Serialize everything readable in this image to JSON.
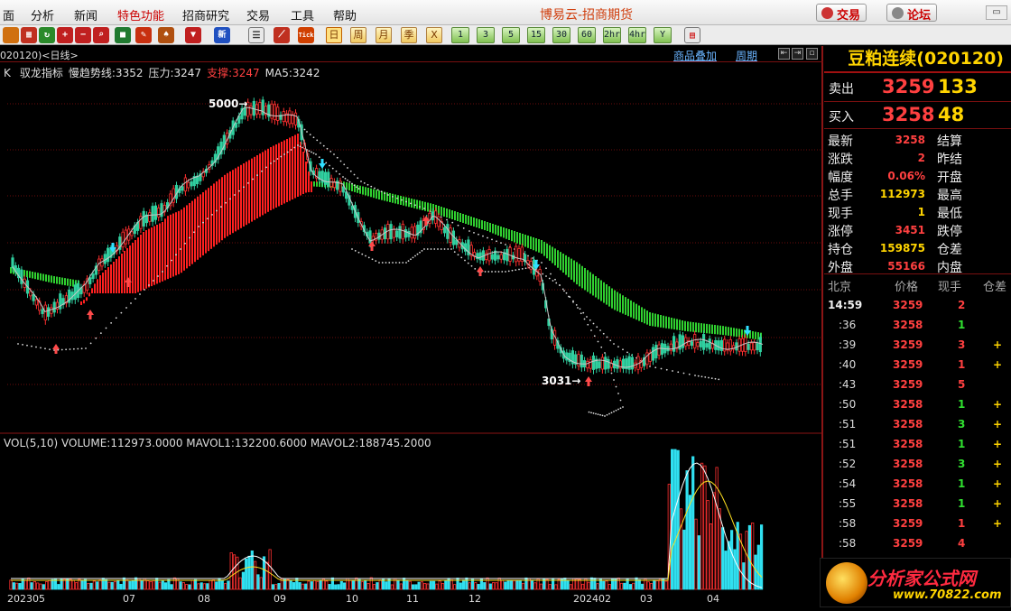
{
  "menu": {
    "items": [
      "面",
      "分析",
      "新闻",
      "特色功能",
      "招商研究",
      "交易",
      "工具",
      "帮助"
    ],
    "title": "博易云-招商期货",
    "trade_btn": "交易",
    "forum_btn": "论坛"
  },
  "toolbar": {
    "periods": [
      "日",
      "周",
      "月",
      "季",
      "X",
      "1",
      "3",
      "5",
      "15",
      "30",
      "60",
      "2hr",
      "4hr",
      "Y"
    ],
    "new_label": "新",
    "tick_label": "Tick"
  },
  "chart": {
    "symbol": "020120)<日线>",
    "overlay_link": "商品叠加",
    "period_link": "周期",
    "k_label": "K",
    "indicator_line": [
      {
        "text": "驭龙指标",
        "color": "#e0e0e0"
      },
      {
        "text": "慢趋势线:3352",
        "color": "#e0e0e0"
      },
      {
        "text": "压力:3247",
        "color": "#e0e0e0"
      },
      {
        "text": "支撑:3247",
        "color": "#ff4040"
      },
      {
        "text": "MA5:3242",
        "color": "#e0e0e0"
      }
    ],
    "high_annotation": "5000→",
    "low_annotation": "3031→",
    "volume_line": "VOL(5,10) VOLUME:112973.0000 MAVOL1:132200.6000 MAVOL2:188745.2000",
    "x_labels": [
      "202305",
      "07",
      "08",
      "09",
      "10",
      "11",
      "12",
      "202402",
      "03",
      "04"
    ]
  },
  "quote": {
    "title": "豆粕连续(020120)",
    "sell": {
      "label": "卖出",
      "price": "3259",
      "vol": "133"
    },
    "buy": {
      "label": "买入",
      "price": "3258",
      "vol": "48"
    },
    "stats": [
      {
        "l1": "最新",
        "v1": "3258",
        "c1": "#ff4040",
        "l2": "结算"
      },
      {
        "l1": "涨跌",
        "v1": "2",
        "c1": "#ff4040",
        "l2": "昨结"
      },
      {
        "l1": "幅度",
        "v1": "0.06%",
        "c1": "#ff4040",
        "l2": "开盘"
      },
      {
        "l1": "总手",
        "v1": "112973",
        "c1": "#ffd400",
        "l2": "最高"
      },
      {
        "l1": "现手",
        "v1": "1",
        "c1": "#ffd400",
        "l2": "最低"
      },
      {
        "l1": "涨停",
        "v1": "3451",
        "c1": "#ff4040",
        "l2": "跌停"
      },
      {
        "l1": "持仓",
        "v1": "159875",
        "c1": "#ffd400",
        "l2": "仓差"
      },
      {
        "l1": "外盘",
        "v1": "55166",
        "c1": "#ff4040",
        "l2": "内盘"
      }
    ],
    "tick_header": [
      "北京",
      "价格",
      "现手",
      "仓差"
    ],
    "ticks": [
      {
        "t": "14:59",
        "p": "3259",
        "v": "2",
        "vc": "#ff4040",
        "d": ""
      },
      {
        "t": ":36",
        "p": "3258",
        "v": "1",
        "vc": "#30e030",
        "d": ""
      },
      {
        "t": ":39",
        "p": "3259",
        "v": "3",
        "vc": "#ff4040",
        "d": "+"
      },
      {
        "t": ":40",
        "p": "3259",
        "v": "1",
        "vc": "#ff4040",
        "d": "+"
      },
      {
        "t": ":43",
        "p": "3259",
        "v": "5",
        "vc": "#ff4040",
        "d": ""
      },
      {
        "t": ":50",
        "p": "3258",
        "v": "1",
        "vc": "#30e030",
        "d": "+"
      },
      {
        "t": ":51",
        "p": "3258",
        "v": "3",
        "vc": "#30e030",
        "d": "+"
      },
      {
        "t": ":51",
        "p": "3258",
        "v": "1",
        "vc": "#30e030",
        "d": "+"
      },
      {
        "t": ":52",
        "p": "3258",
        "v": "3",
        "vc": "#30e030",
        "d": "+"
      },
      {
        "t": ":54",
        "p": "3258",
        "v": "1",
        "vc": "#30e030",
        "d": "+"
      },
      {
        "t": ":55",
        "p": "3258",
        "v": "1",
        "vc": "#30e030",
        "d": "+"
      },
      {
        "t": ":58",
        "p": "3259",
        "v": "1",
        "vc": "#ff4040",
        "d": "+"
      },
      {
        "t": ":58",
        "p": "3259",
        "v": "4",
        "vc": "#ff4040",
        "d": ""
      }
    ]
  },
  "watermark": {
    "text": "分析家公式网",
    "url": "www.70822.com"
  }
}
